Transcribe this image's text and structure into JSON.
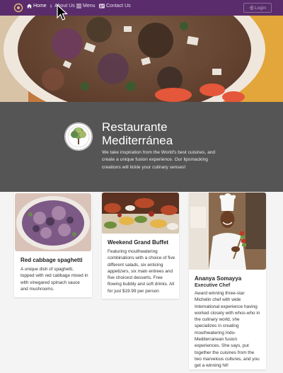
{
  "navbar": {
    "items": [
      {
        "label": "Home",
        "icon": "home-icon",
        "active": true
      },
      {
        "label": "About Us",
        "icon": "info-icon",
        "active": false
      },
      {
        "label": "Menu",
        "icon": "list-icon",
        "active": false
      },
      {
        "label": "Contact Us",
        "icon": "address-card-icon",
        "active": false
      }
    ],
    "login_label": "Login"
  },
  "jumbotron": {
    "title_line1": "Restaurante",
    "title_line2": "Mediterránea",
    "text": "We take inspiration from the World's best cuisines, and create a unique fusion experience. Our lipsmacking creations will tickle your culinary senses!"
  },
  "cards": [
    {
      "title": "Red cabbage spaghetti",
      "text": "A unique dish of spaghetti, topped with red cabbage mixed in with vinegared spinach sauce and mushrooms."
    },
    {
      "title": "Weekend Grand Buffet",
      "text": "Featuring mouthwatering combinations with a choice of five different salads, six enticing appetizers, six main entrees and five choicest desserts. Free flowing bubbly and soft drinks. All for just $19.99 per person"
    },
    {
      "title": "Ananya Somayya",
      "subtitle": "Executive Chef",
      "text": "Award winning three-star Michelin chef with wide International experience having worked closely with whos-who in the culinary world, she specializes in creating mouthwatering Indo-Mediterranean fusion experiences. She says, put together the cuisines from the two marvelous cultures, and you get a winning hit!"
    }
  ],
  "colors": {
    "navbar": "#5a2c6b",
    "jumbotron": "#555555",
    "background": "#f4f4f4"
  }
}
